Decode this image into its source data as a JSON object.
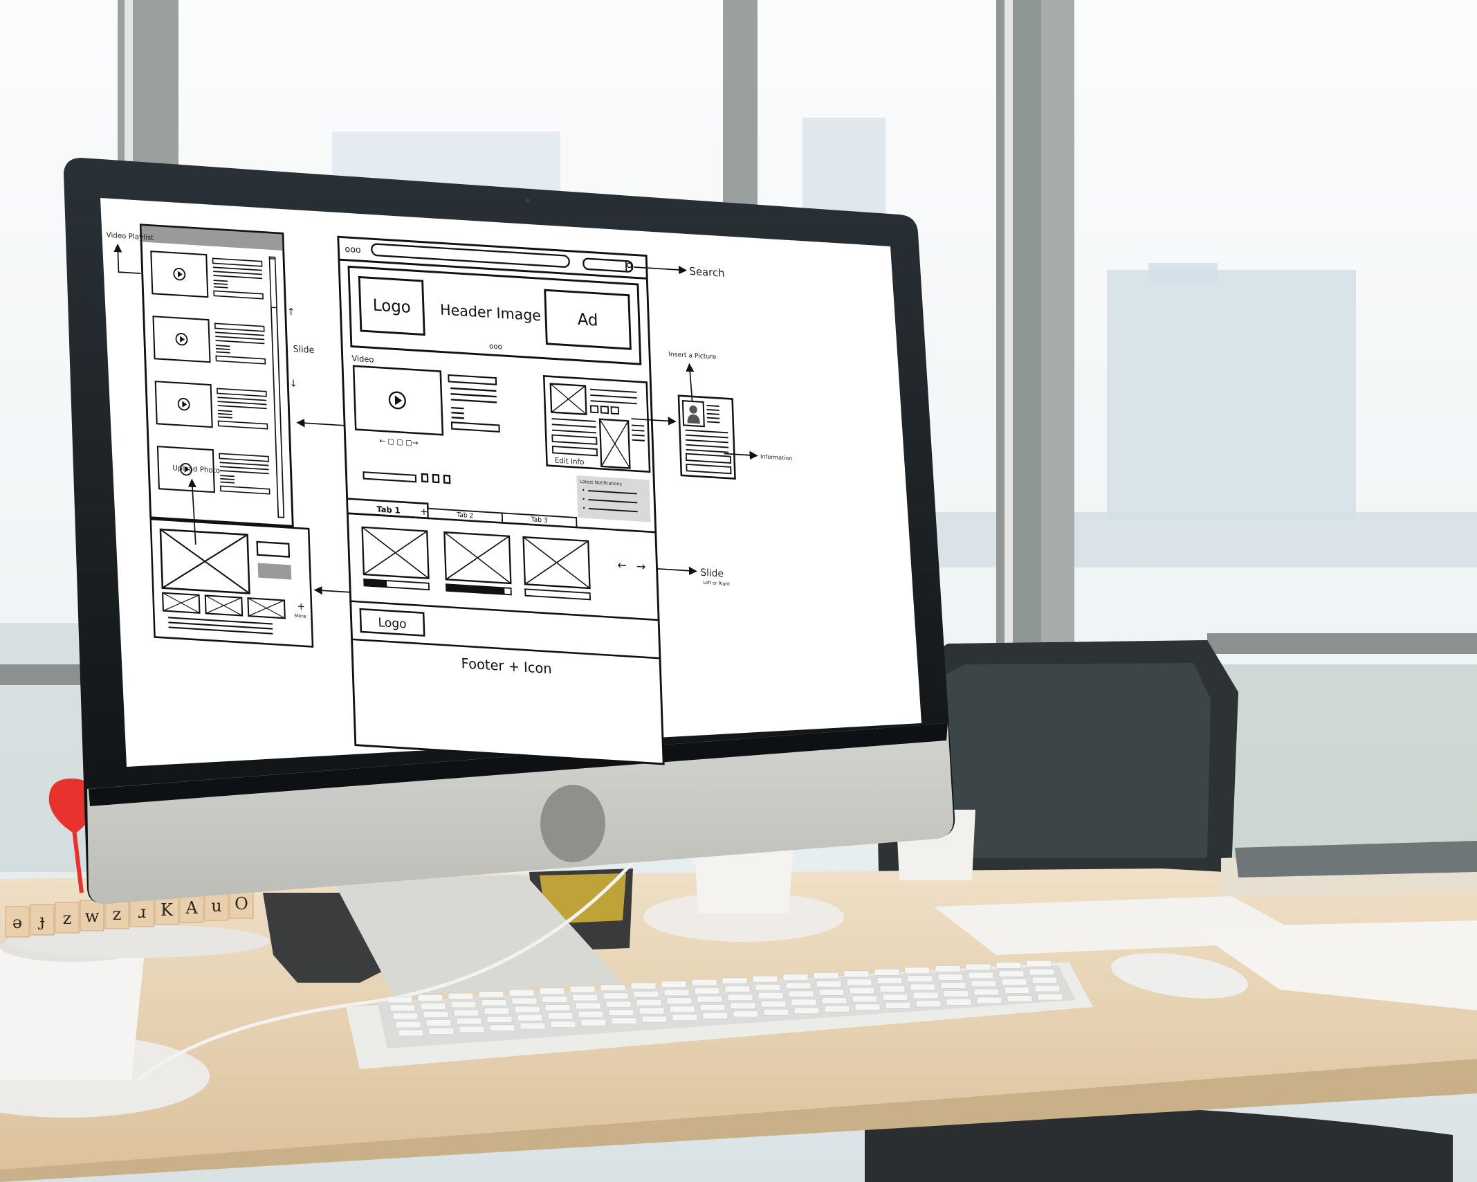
{
  "scene": {
    "description": "Desktop computer on office desk displaying a website wireframe",
    "colors": {
      "window_light": "#f6f8f9",
      "window_frame": "#8c9391",
      "building_haze": "#d6e2ea",
      "bezel": "#15191c",
      "aluminum": "#c9c9c5",
      "apple_logo": "#8f8f8c",
      "desk": "#e6d2b5",
      "desk_edge": "#cdb690",
      "chair": "#2b2f31",
      "screen_bg": "#ffffff",
      "ink": "#111111",
      "gray_fill": "#9a9a9a",
      "notification_bg": "#d9d9d9",
      "dart_red": "#e8322e",
      "pencil_yellow": "#d8b638"
    },
    "wood_blocks": [
      "ə",
      "ɟ",
      "z",
      "w",
      "z",
      "ɹ",
      "K",
      "A",
      "u",
      "O"
    ]
  },
  "wireframe": {
    "playlist": {
      "label": "Video Playlist",
      "slide_label": "Slide",
      "items": 4
    },
    "browser": {
      "dots": "ooo",
      "search_label": "Search",
      "header": {
        "logo": "Logo",
        "title": "Header Image",
        "ad": "Ad",
        "pager_dots": "ooo"
      },
      "video_label": "Video",
      "edit_info_label": "Edit Info",
      "notifications": {
        "title": "Latest Notifications",
        "bullet": "•",
        "count": 3
      },
      "tabs": [
        {
          "label": "Tab 1",
          "active": true
        },
        {
          "label": "Tab 2",
          "active": false
        },
        {
          "label": "Tab 3",
          "active": false
        }
      ],
      "tab_add": "+",
      "gallery": {
        "progress": [
          0.35,
          0.9,
          0.0
        ],
        "prev": "←",
        "next": "→"
      },
      "footer_logo": "Logo",
      "footer": "Footer + Icon"
    },
    "profile_card": {
      "insert_label": "Insert a Picture",
      "info_label": "Information"
    },
    "upload": {
      "label": "Upload Photo",
      "more_plus": "+",
      "more": "More"
    },
    "slide_right": {
      "label": "Slide",
      "sub": "Left or Right"
    }
  }
}
